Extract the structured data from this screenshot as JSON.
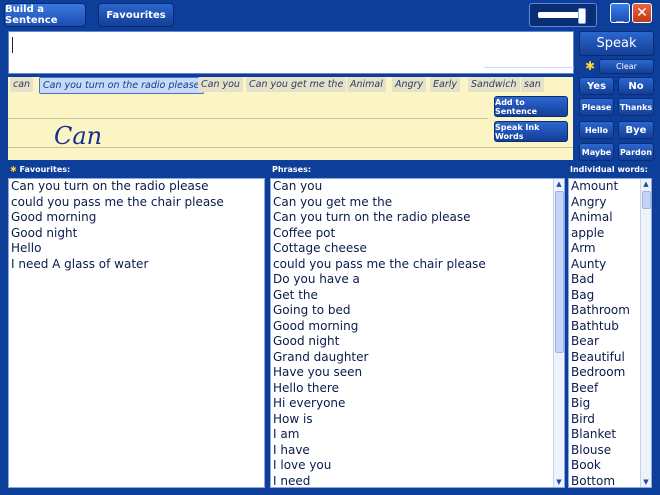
{
  "nav": {
    "build_sentence": "Build a Sentence",
    "favourites": "Favourites"
  },
  "volume": {
    "level_fraction": 0.85
  },
  "window": {
    "minimize": "_",
    "close": "✕"
  },
  "input": {
    "value": ""
  },
  "actions": {
    "speak": "Speak",
    "clear": "Clear"
  },
  "suggestions": {
    "items": [
      "can",
      "Can you turn on the radio please",
      "Can you",
      "Can you get me the",
      "Animal",
      "Angry",
      "Early",
      "Sandwich",
      "san"
    ],
    "selected_index": 1
  },
  "ink": {
    "handwriting": "Can",
    "add_to_sentence": "Add  to Sentence",
    "speak_ink_words": "Speak Ink Words"
  },
  "quick_buttons": [
    "Yes",
    "No",
    "Please",
    "Thanks",
    "Hello",
    "Bye",
    "Maybe",
    "Pardon"
  ],
  "favourites": {
    "label": "Favourites:",
    "items": [
      "Can you turn on the radio please",
      "could you pass me the chair please",
      "Good morning",
      "Good night",
      "Hello",
      "I need A glass of water"
    ]
  },
  "phrases": {
    "label": "Phrases:",
    "items": [
      "Can you",
      "Can you get me the",
      "Can you turn on the radio please",
      "Coffee pot",
      "Cottage cheese",
      "could you pass me the chair please",
      "Do you have a",
      "Get the",
      "Going to bed",
      "Good morning",
      "Good night",
      "Grand daughter",
      "Have you seen",
      "Hello there",
      "Hi everyone",
      "How is",
      "I am",
      "I have",
      "I love you",
      "I need"
    ]
  },
  "words": {
    "label": "Individual words:",
    "items": [
      "Amount",
      "Angry",
      "Animal",
      "apple",
      "Arm",
      "Aunty",
      "Bad",
      "Bag",
      "Bathroom",
      "Bathtub",
      "Bear",
      "Beautiful",
      "Bedroom",
      "Beef",
      "Big",
      "Bird",
      "Blanket",
      "Blouse",
      "Book",
      "Bottom"
    ]
  },
  "colors": {
    "background": "#0d3f9a",
    "ink_panel": "#fbf4c5",
    "button": "#1f57c0",
    "selected_suggestion": "#c7daf7",
    "star": "#ffd431"
  },
  "icons": {
    "favourite_star": "star-icon",
    "clear_star": "star-icon"
  }
}
